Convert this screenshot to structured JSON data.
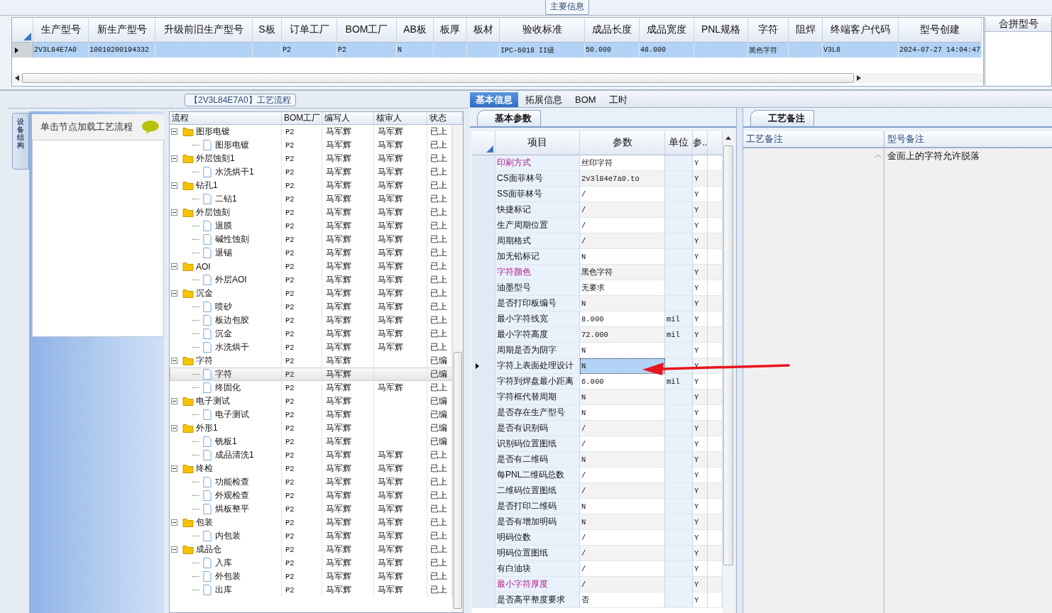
{
  "main_info": {
    "title": "主要信息",
    "columns": [
      "生产型号",
      "新生产型号",
      "升级前旧生产型号",
      "S板",
      "订单工厂",
      "BOM工厂",
      "AB板",
      "板厚",
      "板材",
      "验收标准",
      "成品长度",
      "成品宽度",
      "PNL规格",
      "字符",
      "阻焊",
      "终端客户代码",
      "型号创建"
    ],
    "rows": [
      {
        "selected": true,
        "cells": [
          "2V3L84E7A0",
          "10010200194332",
          null,
          null,
          "P2",
          "P2",
          "N",
          null,
          null,
          "IPC-6018 II级",
          "50.000",
          "48.000",
          null,
          "黑色字符",
          null,
          "V3L8",
          "2024-07-27 14:04:47"
        ]
      }
    ]
  },
  "merge_panel": {
    "title": "合拼型号"
  },
  "process_panel": {
    "title": "【2V3L84E7A0】工艺流程",
    "side_tab": "设备结构",
    "hint": "单击节点加载工艺流程",
    "columns": [
      "流程",
      "BOM工厂",
      "编写人",
      "核审人",
      "状态"
    ],
    "nodes": [
      {
        "name": "图形电镀",
        "bom": "P2",
        "writer": "马军辉",
        "reviewer": "马军辉",
        "status": "已上",
        "expanded": true,
        "selected": false,
        "children": [
          {
            "name": "图形电镀",
            "bom": "P2",
            "writer": "马军辉",
            "reviewer": "马军辉",
            "status": "已上",
            "selected": false
          }
        ]
      },
      {
        "name": "外层蚀刻1",
        "bom": "P2",
        "writer": "马军辉",
        "reviewer": "马军辉",
        "status": "已上",
        "expanded": true,
        "selected": false,
        "children": [
          {
            "name": "水洗烘干1",
            "bom": "P2",
            "writer": "马军辉",
            "reviewer": "马军辉",
            "status": "已上",
            "selected": false
          }
        ]
      },
      {
        "name": "钻孔1",
        "bom": "P2",
        "writer": "马军辉",
        "reviewer": "马军辉",
        "status": "已上",
        "expanded": true,
        "selected": false,
        "children": [
          {
            "name": "二钻1",
            "bom": "P2",
            "writer": "马军辉",
            "reviewer": "马军辉",
            "status": "已上",
            "selected": false
          }
        ]
      },
      {
        "name": "外层蚀刻",
        "bom": "P2",
        "writer": "马军辉",
        "reviewer": "马军辉",
        "status": "已上",
        "expanded": true,
        "selected": false,
        "children": [
          {
            "name": "退膜",
            "bom": "P2",
            "writer": "马军辉",
            "reviewer": "马军辉",
            "status": "已上",
            "selected": false
          },
          {
            "name": "碱性蚀刻",
            "bom": "P2",
            "writer": "马军辉",
            "reviewer": "马军辉",
            "status": "已上",
            "selected": false
          },
          {
            "name": "退锡",
            "bom": "P2",
            "writer": "马军辉",
            "reviewer": "马军辉",
            "status": "已上",
            "selected": false
          }
        ]
      },
      {
        "name": "AOI",
        "bom": "P2",
        "writer": "马军辉",
        "reviewer": "马军辉",
        "status": "已上",
        "expanded": true,
        "selected": false,
        "children": [
          {
            "name": "外层AOI",
            "bom": "P2",
            "writer": "马军辉",
            "reviewer": "马军辉",
            "status": "已上",
            "selected": false
          }
        ]
      },
      {
        "name": "沉金",
        "bom": "P2",
        "writer": "马军辉",
        "reviewer": "马军辉",
        "status": "已上",
        "expanded": true,
        "selected": false,
        "children": [
          {
            "name": "喷砂",
            "bom": "P2",
            "writer": "马军辉",
            "reviewer": "马军辉",
            "status": "已上",
            "selected": false
          },
          {
            "name": "板边包胶",
            "bom": "P2",
            "writer": "马军辉",
            "reviewer": "马军辉",
            "status": "已上",
            "selected": false
          },
          {
            "name": "沉金",
            "bom": "P2",
            "writer": "马军辉",
            "reviewer": "马军辉",
            "status": "已上",
            "selected": false
          },
          {
            "name": "水洗烘干",
            "bom": "P2",
            "writer": "马军辉",
            "reviewer": "马军辉",
            "status": "已上",
            "selected": false
          }
        ]
      },
      {
        "name": "字符",
        "bom": "P2",
        "writer": "马军辉",
        "status": "已编",
        "expanded": true,
        "selected": false,
        "children": [
          {
            "name": "字符",
            "bom": "P2",
            "writer": "马军辉",
            "status": "已编",
            "selected": true
          },
          {
            "name": "终固化",
            "bom": "P2",
            "writer": "马军辉",
            "reviewer": "马军辉",
            "status": "已上",
            "selected": false
          }
        ]
      },
      {
        "name": "电子测试",
        "bom": "P2",
        "writer": "马军辉",
        "status": "已编",
        "expanded": true,
        "selected": false,
        "children": [
          {
            "name": "电子测试",
            "bom": "P2",
            "writer": "马军辉",
            "status": "已编",
            "selected": false
          }
        ]
      },
      {
        "name": "外形1",
        "bom": "P2",
        "writer": "马军辉",
        "status": "已编",
        "expanded": true,
        "selected": false,
        "children": [
          {
            "name": "铣板1",
            "bom": "P2",
            "writer": "马军辉",
            "status": "已编",
            "selected": false
          },
          {
            "name": "成品清洗1",
            "bom": "P2",
            "writer": "马军辉",
            "reviewer": "马军辉",
            "status": "已上",
            "selected": false
          }
        ]
      },
      {
        "name": "终检",
        "bom": "P2",
        "writer": "马军辉",
        "reviewer": "马军辉",
        "status": "已上",
        "expanded": true,
        "selected": false,
        "children": [
          {
            "name": "功能检查",
            "bom": "P2",
            "writer": "马军辉",
            "reviewer": "马军辉",
            "status": "已上",
            "selected": false
          },
          {
            "name": "外观检查",
            "bom": "P2",
            "writer": "马军辉",
            "reviewer": "马军辉",
            "status": "已上",
            "selected": false
          },
          {
            "name": "烘板整平",
            "bom": "P2",
            "writer": "马军辉",
            "reviewer": "马军辉",
            "status": "已上",
            "selected": false
          }
        ]
      },
      {
        "name": "包装",
        "bom": "P2",
        "writer": "马军辉",
        "reviewer": "马军辉",
        "status": "已上",
        "expanded": true,
        "selected": false,
        "children": [
          {
            "name": "内包装",
            "bom": "P2",
            "writer": "马军辉",
            "reviewer": "马军辉",
            "status": "已上",
            "selected": false
          }
        ]
      },
      {
        "name": "成品仓",
        "bom": "P2",
        "writer": "马军辉",
        "reviewer": "马军辉",
        "status": "已上",
        "expanded": true,
        "selected": false,
        "children": [
          {
            "name": "入库",
            "bom": "P2",
            "writer": "马军辉",
            "reviewer": "马军辉",
            "status": "已上",
            "selected": false
          },
          {
            "name": "外包装",
            "bom": "P2",
            "writer": "马军辉",
            "reviewer": "马军辉",
            "status": "已上",
            "selected": false
          },
          {
            "name": "出库",
            "bom": "P2",
            "writer": "马军辉",
            "reviewer": "马军辉",
            "status": "已上",
            "selected": false
          }
        ]
      }
    ]
  },
  "detail_tabs": [
    {
      "label": "基本信息",
      "selected": true
    },
    {
      "label": "拓展信息",
      "selected": false
    },
    {
      "label": "BOM",
      "selected": false
    },
    {
      "label": "工时",
      "selected": false
    }
  ],
  "params": {
    "tab": "基本参数",
    "columns": [
      "项目",
      "参数",
      "单位",
      "参.."
    ],
    "rows": [
      {
        "item": "印刷方式",
        "value": "丝印字符",
        "flag": "Y",
        "highlighted": true,
        "selected": false
      },
      {
        "item": "CS面菲林号",
        "value": "2v3l84e7a0.to",
        "flag": "Y",
        "highlighted": false,
        "selected": false
      },
      {
        "item": "SS面菲林号",
        "value": "/",
        "flag": "Y",
        "highlighted": false,
        "selected": false
      },
      {
        "item": "快捷标记",
        "value": "/",
        "flag": "Y",
        "highlighted": false,
        "selected": false
      },
      {
        "item": "生产周期位置",
        "value": "/",
        "flag": "Y",
        "highlighted": false,
        "selected": false
      },
      {
        "item": "周期格式",
        "value": "/",
        "flag": "Y",
        "highlighted": false,
        "selected": false
      },
      {
        "item": "加无铅标记",
        "value": "N",
        "flag": "Y",
        "highlighted": false,
        "selected": false
      },
      {
        "item": "字符颜色",
        "value": "黑色字符",
        "flag": "Y",
        "highlighted": true,
        "selected": false
      },
      {
        "item": "油墨型号",
        "value": "无要求",
        "flag": "Y",
        "highlighted": false,
        "selected": false
      },
      {
        "item": "是否打印板编号",
        "value": "N",
        "flag": "Y",
        "highlighted": false,
        "selected": false
      },
      {
        "item": "最小字符线宽",
        "value": "8.000",
        "unit": "mil",
        "flag": "Y",
        "highlighted": false,
        "selected": false
      },
      {
        "item": "最小字符高度",
        "value": "72.000",
        "unit": "mil",
        "flag": "Y",
        "highlighted": false,
        "selected": false
      },
      {
        "item": "周期是否为阴字",
        "value": "N",
        "flag": "Y",
        "highlighted": false,
        "selected": false
      },
      {
        "item": "字符上表面处理设计",
        "value": "N",
        "flag": "Y",
        "highlighted": false,
        "selected": true
      },
      {
        "item": "字符到焊盘最小距离",
        "value": "6.000",
        "unit": "mil",
        "flag": "Y",
        "highlighted": false,
        "selected": false
      },
      {
        "item": "字符框代替周期",
        "value": "N",
        "flag": "Y",
        "highlighted": false,
        "selected": false
      },
      {
        "item": "是否存在生产型号",
        "value": "N",
        "flag": "Y",
        "highlighted": false,
        "selected": false
      },
      {
        "item": "是否有识别码",
        "value": "/",
        "flag": "Y",
        "highlighted": false,
        "selected": false
      },
      {
        "item": "识别码位置图纸",
        "value": "/",
        "flag": "Y",
        "highlighted": false,
        "selected": false
      },
      {
        "item": "是否有二维码",
        "value": "N",
        "flag": "Y",
        "highlighted": false,
        "selected": false
      },
      {
        "item": "每PNL二维码总数",
        "value": "/",
        "flag": "Y",
        "highlighted": false,
        "selected": false
      },
      {
        "item": "二维码位置图纸",
        "value": "/",
        "flag": "Y",
        "highlighted": false,
        "selected": false
      },
      {
        "item": "是否打印二维码",
        "value": "N",
        "flag": "Y",
        "highlighted": false,
        "selected": false
      },
      {
        "item": "是否有增加明码",
        "value": "N",
        "flag": "Y",
        "highlighted": false,
        "selected": false
      },
      {
        "item": "明码位数",
        "value": "/",
        "flag": "Y",
        "highlighted": false,
        "selected": false
      },
      {
        "item": "明码位置图纸",
        "value": "/",
        "flag": "Y",
        "highlighted": false,
        "selected": false
      },
      {
        "item": "有白油块",
        "value": "/",
        "flag": "Y",
        "highlighted": false,
        "selected": false
      },
      {
        "item": "最小字符厚度",
        "value": "/",
        "flag": "Y",
        "highlighted": true,
        "selected": false
      },
      {
        "item": "是否高平整度要求",
        "value": "否",
        "flag": "Y",
        "highlighted": false,
        "selected": false
      }
    ]
  },
  "notes": {
    "tab": "工艺备注",
    "columns": [
      "工艺备注",
      "型号备注"
    ],
    "model_note": "金面上的字符允许脱落"
  }
}
